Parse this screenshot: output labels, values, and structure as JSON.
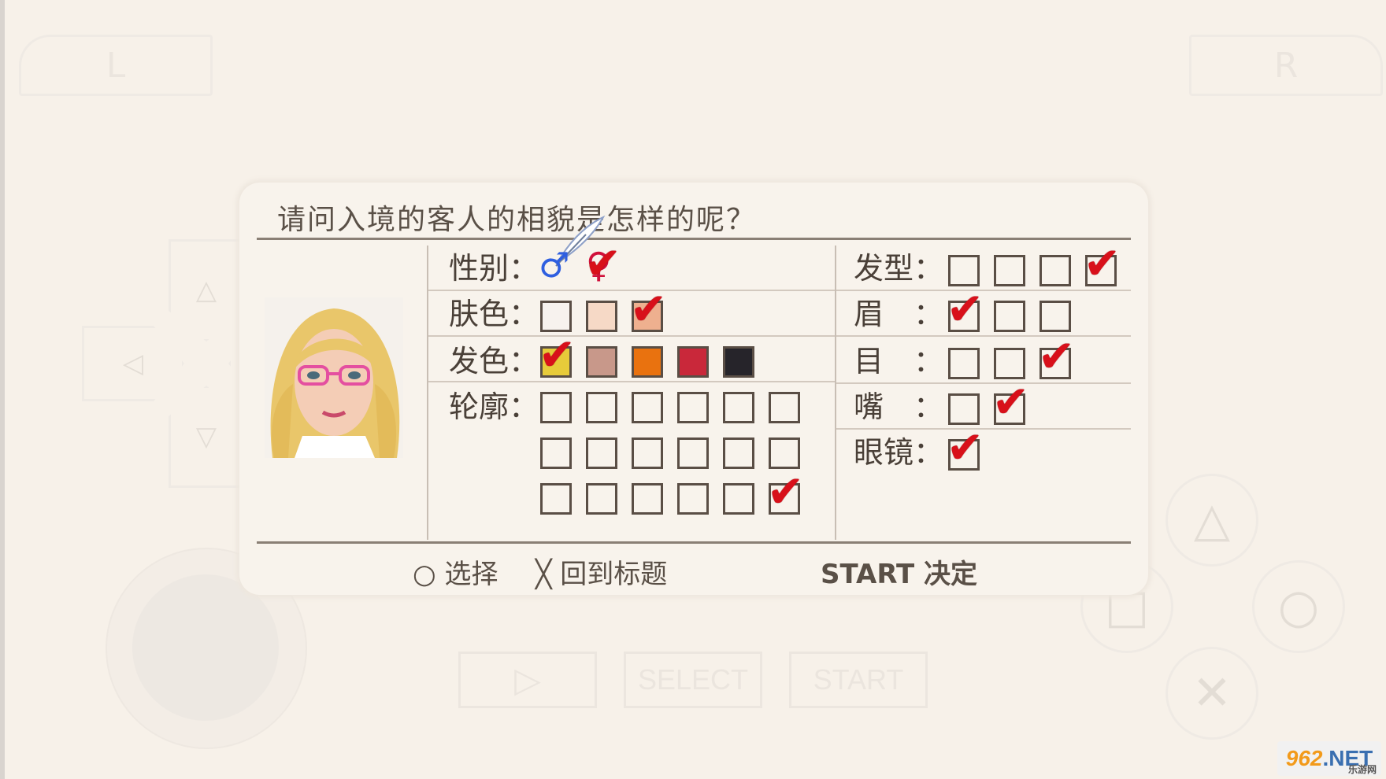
{
  "emulator": {
    "l_label": "L",
    "r_label": "R",
    "select_label": "SELECT",
    "start_label": "START",
    "play_glyph": "▷",
    "dpad": {
      "up": "△",
      "down": "▽",
      "left": "◁",
      "right": "▷"
    },
    "face": {
      "triangle": "△",
      "square": "□",
      "circle": "○",
      "cross": "✕"
    }
  },
  "dialog": {
    "question": "请问入境的客人的相貌是怎样的呢？",
    "left_rows": [
      {
        "label": "性别：",
        "kind": "gender",
        "options": [
          "♂",
          "♀"
        ],
        "selected": 1
      },
      {
        "label": "肤色：",
        "kind": "boxes",
        "count": 3,
        "selected": 2,
        "fills": [
          "#f7f2ee",
          "#f6d9c6",
          "#eeb08f"
        ]
      },
      {
        "label": "发色：",
        "kind": "boxes",
        "count": 5,
        "selected": 0,
        "fills": [
          "#e7cb3a",
          "#c8988a",
          "#e9720f",
          "#c9283a",
          "#26242a"
        ]
      },
      {
        "label": "轮廓：",
        "kind": "grid",
        "rows": 3,
        "cols": 6,
        "selected_row": 2,
        "selected_col": 5
      }
    ],
    "right_rows": [
      {
        "label": "发型：",
        "count": 4,
        "selected": 3
      },
      {
        "label": "眉　：",
        "count": 3,
        "selected": 0
      },
      {
        "label": "目　：",
        "count": 3,
        "selected": 2
      },
      {
        "label": "嘴　：",
        "count": 2,
        "selected": 1
      },
      {
        "label": "眼镜：",
        "count": 1,
        "selected": 0
      }
    ],
    "footer": {
      "select_icon": "○",
      "select_label": "选择",
      "back_icon": "╳",
      "back_label": "回到标题",
      "confirm_label": "START 决定"
    },
    "check_mark": "✔"
  },
  "colors": {
    "check": "#d8101a",
    "male": "#2f5fe0",
    "female": "#d0103a"
  },
  "watermark": {
    "text_a": "962",
    "text_b": ".NET",
    "sub": "乐游网"
  }
}
